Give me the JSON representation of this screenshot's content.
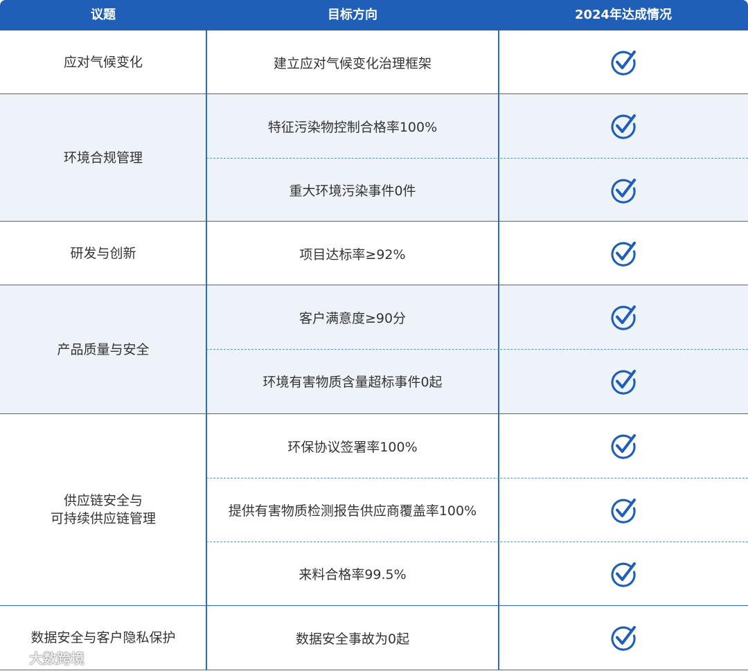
{
  "header": {
    "col_topic": "议题",
    "col_target": "目标方向",
    "col_status": "2024年达成情况"
  },
  "groups": [
    {
      "topic": "应对气候变化",
      "targets": [
        "建立应对气候变化治理框架"
      ]
    },
    {
      "topic": "环境合规管理",
      "targets": [
        "特征污染物控制合格率100%",
        "重大环境污染事件0件"
      ]
    },
    {
      "topic": "研发与创新",
      "targets": [
        "项目达标率≥92%"
      ]
    },
    {
      "topic": "产品质量与安全",
      "targets": [
        "客户满意度≥90分",
        "环境有害物质含量超标事件0起"
      ]
    },
    {
      "topic": "供应链安全与\n可持续供应链管理",
      "targets": [
        "环保协议签署率100%",
        "提供有害物质检测报告供应商覆盖率100%",
        "来料合格率99.5%"
      ]
    },
    {
      "topic": "数据安全与客户隐私保护",
      "targets": [
        "数据安全事故为0起"
      ]
    }
  ],
  "status_icon": "check-circle-icon",
  "watermark": {
    "text": "大数跨境",
    "icon": "chat-logo-icon"
  },
  "colors": {
    "header_bg": "#1f5fb8",
    "line": "#2c6cc0",
    "shade": "#eef2f9",
    "check": "#1f5fb8"
  }
}
